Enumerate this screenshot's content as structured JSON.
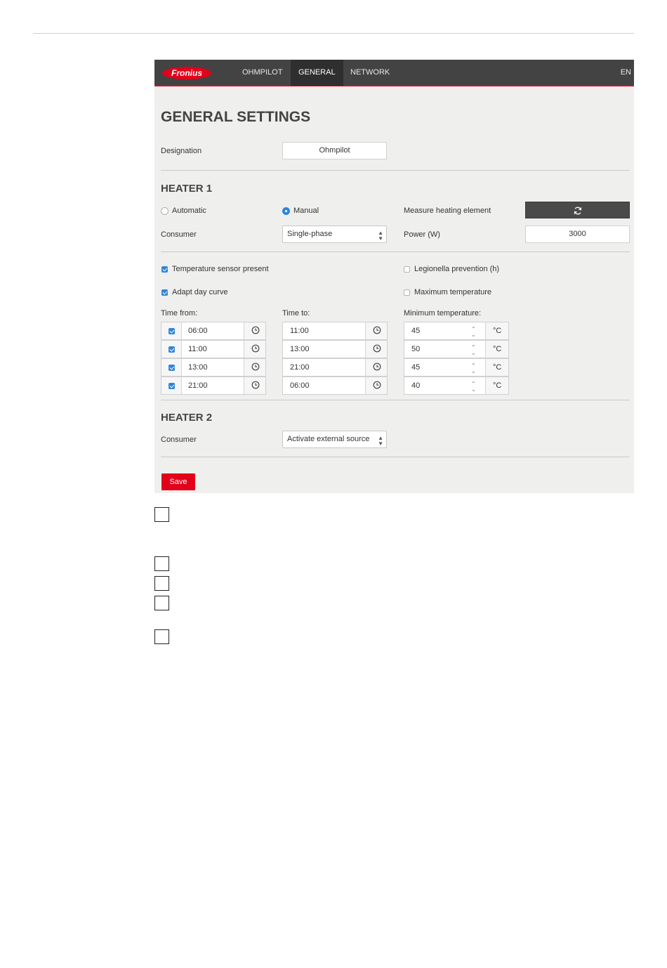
{
  "brand": {
    "logo_text": "Fronius",
    "accent": "#e2001a",
    "navbar_bg": "#434343"
  },
  "nav": {
    "items": [
      "OHMPILOT",
      "GENERAL",
      "NETWORK"
    ],
    "active": "GENERAL",
    "language": "EN"
  },
  "page_title": "GENERAL SETTINGS",
  "designation": {
    "label": "Designation",
    "value": "Ohmpilot"
  },
  "heater1": {
    "title": "HEATER 1",
    "mode_automatic": "Automatic",
    "mode_manual": "Manual",
    "mode_selected": "Manual",
    "measure_label": "Measure heating element",
    "measure_button_icon": "refresh-icon",
    "consumer_label": "Consumer",
    "consumer_value": "Single-phase",
    "power_label": "Power (W)",
    "power_value": "3000",
    "temp_sensor_label": "Temperature sensor present",
    "temp_sensor_checked": true,
    "adapt_curve_label": "Adapt day curve",
    "adapt_curve_checked": true,
    "legionella_label": "Legionella prevention (h)",
    "legionella_checked": false,
    "max_temp_label": "Maximum temperature",
    "max_temp_checked": false,
    "time_from_label": "Time from:",
    "time_to_label": "Time to:",
    "min_temp_label": "Minimum temperature:",
    "unit": "°C",
    "schedule": [
      {
        "enabled": true,
        "from": "06:00",
        "to": "11:00",
        "min_temp": "45"
      },
      {
        "enabled": true,
        "from": "11:00",
        "to": "13:00",
        "min_temp": "50"
      },
      {
        "enabled": true,
        "from": "13:00",
        "to": "21:00",
        "min_temp": "45"
      },
      {
        "enabled": true,
        "from": "21:00",
        "to": "06:00",
        "min_temp": "40"
      }
    ]
  },
  "heater2": {
    "title": "HEATER 2",
    "consumer_label": "Consumer",
    "consumer_value": "Activate external source"
  },
  "save_label": "Save"
}
